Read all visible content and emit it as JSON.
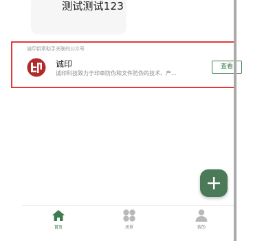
{
  "top_card": {
    "title": "测试测试123"
  },
  "official_account": {
    "caption": "诚印钥章助手关联的公众号",
    "name": "诚印",
    "description": "诚印科技致力于印章防伪和文件防伪的技术、产...",
    "view_label": "查看",
    "logo_color": "#b32a2a"
  },
  "fab": {
    "icon": "plus-icon",
    "color": "#4a7a57"
  },
  "bottom_nav": {
    "items": [
      {
        "label": "首页",
        "icon": "home-icon",
        "active": true
      },
      {
        "label": "场景",
        "icon": "grid-icon",
        "active": false
      },
      {
        "label": "我的",
        "icon": "person-icon",
        "active": false
      }
    ]
  },
  "colors": {
    "accent": "#3e7d52",
    "highlight_border": "#e13a36",
    "divider": "#a9a9a9"
  }
}
